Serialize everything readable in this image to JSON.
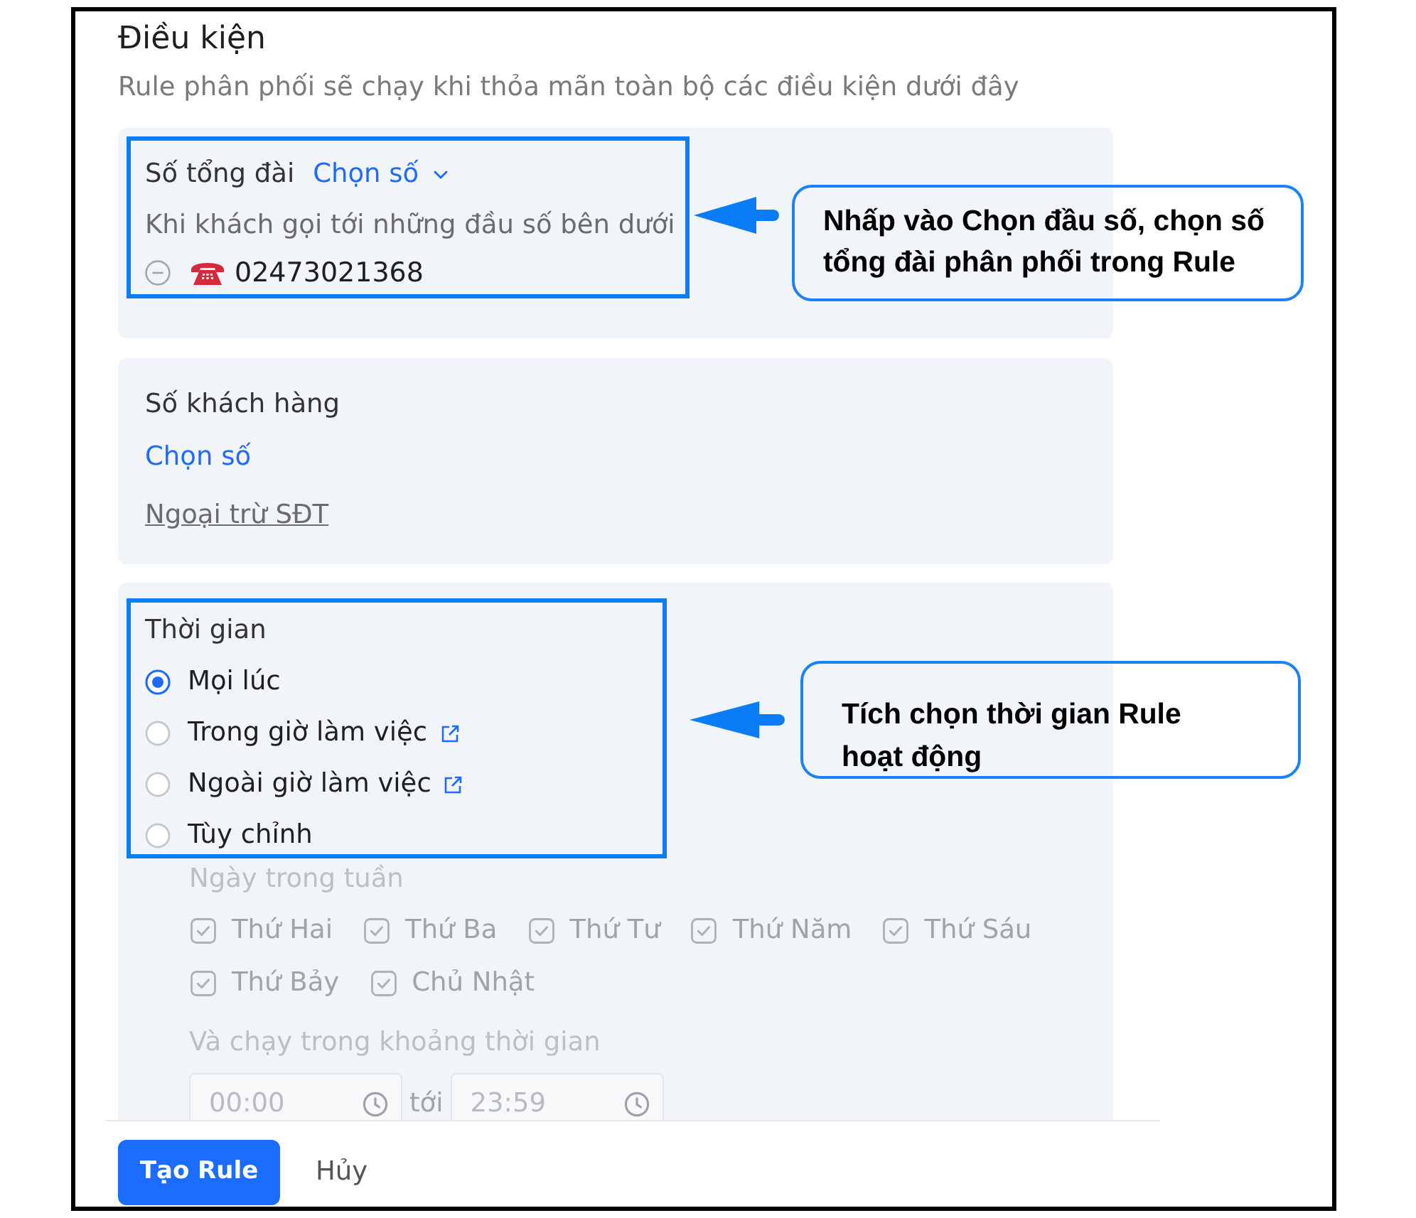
{
  "conditions": {
    "title": "Điều kiện",
    "subtitle": "Rule phân phối sẽ chạy khi thỏa mãn toàn bộ các điều kiện dưới đây"
  },
  "switchboard_card": {
    "label": "Số tổng đài",
    "picker": "Chọn số",
    "hint": "Khi khách gọi tới những đầu số bên dưới",
    "numbers": [
      "02473021368"
    ],
    "annotation": "Nhấp vào Chọn đầu số, chọn số tổng đài phân phối trong Rule"
  },
  "customer_card": {
    "label": "Số khách hàng",
    "picker": "Chọn số",
    "exclude_link": "Ngoại trừ SĐT"
  },
  "time_card": {
    "label": "Thời gian",
    "options": [
      {
        "label": "Mọi lúc",
        "selected": true,
        "link_icon": false
      },
      {
        "label": "Trong giờ làm việc",
        "selected": false,
        "link_icon": true
      },
      {
        "label": "Ngoài giờ làm việc",
        "selected": false,
        "link_icon": true
      },
      {
        "label": "Tùy chỉnh",
        "selected": false,
        "link_icon": false
      }
    ],
    "custom": {
      "disabled": true,
      "weekdays_label": "Ngày trong tuần",
      "weekdays": [
        {
          "label": "Thứ Hai",
          "checked": true
        },
        {
          "label": "Thứ Ba",
          "checked": true
        },
        {
          "label": "Thứ Tư",
          "checked": true
        },
        {
          "label": "Thứ Năm",
          "checked": true
        },
        {
          "label": "Thứ Sáu",
          "checked": true
        },
        {
          "label": "Thứ Bảy",
          "checked": true
        },
        {
          "label": "Chủ Nhật",
          "checked": true
        }
      ],
      "range_label": "Và chạy trong khoảng thời gian",
      "from_time": "00:00",
      "separator": "tới",
      "to_time": "23:59"
    },
    "annotation": "Tích chọn thời gian Rule hoạt động"
  },
  "footer": {
    "buttons": [
      {
        "label": "Tạo Rule",
        "kind": "primary"
      },
      {
        "label": "Hủy",
        "kind": "text"
      }
    ]
  }
}
